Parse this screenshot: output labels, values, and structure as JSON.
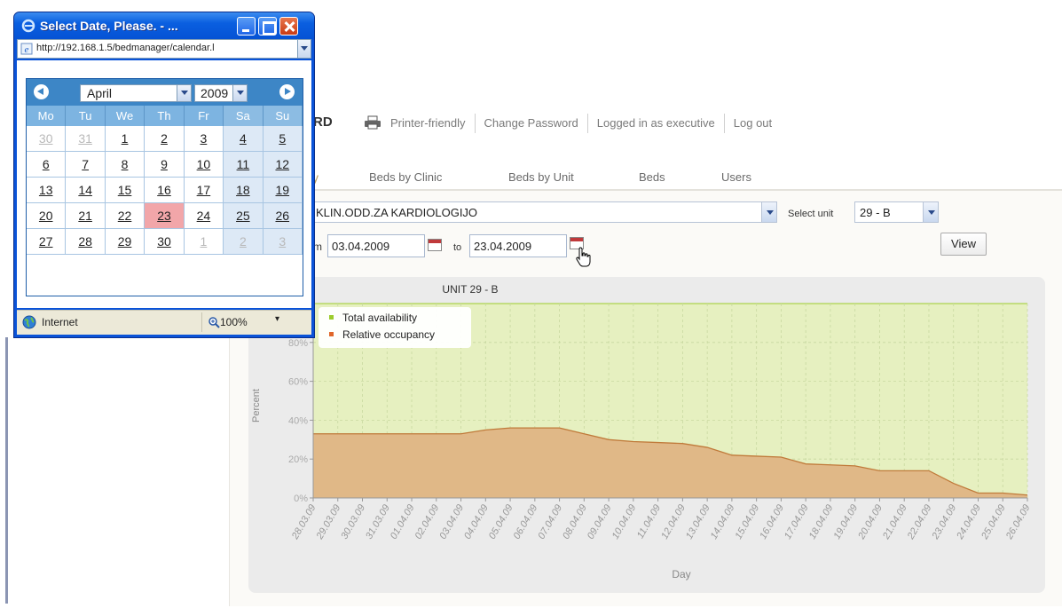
{
  "page": {
    "title_fragment": "RD",
    "nav": {
      "printer_friendly": "Printer-friendly",
      "change_password": "Change Password",
      "logged_in_prefix": "Logged in as",
      "logged_in_user": "executive",
      "log_out": "Log out"
    },
    "tabs": [
      "Beds by Clinic",
      "Beds by Unit",
      "Beds",
      "Users"
    ],
    "active_tab_fragment": "y",
    "clinic_select": "KLIN.ODD.ZA KARDIOLOGIJO",
    "select_unit_label": "Select unit",
    "unit_select": "29 - B",
    "from_label_fragment": "m",
    "from_date": "03.04.2009",
    "to_label": "to",
    "to_date": "23.04.2009",
    "view_button": "View"
  },
  "chart_data": {
    "type": "area",
    "title": "UNIT 29 - B",
    "xlabel": "Day",
    "ylabel": "Percent",
    "ylim": [
      0,
      100
    ],
    "yticks": [
      "0%",
      "20%",
      "40%",
      "60%",
      "80%"
    ],
    "grid": true,
    "legend_position": "top-left",
    "x": [
      "28.03.09",
      "29.03.09",
      "30.03.09",
      "31.03.09",
      "01.04.09",
      "02.04.09",
      "03.04.09",
      "04.04.09",
      "05.04.09",
      "06.04.09",
      "07.04.09",
      "08.04.09",
      "09.04.09",
      "10.04.09",
      "11.04.09",
      "12.04.09",
      "13.04.09",
      "14.04.09",
      "15.04.09",
      "16.04.09",
      "17.04.09",
      "18.04.09",
      "19.04.09",
      "20.04.09",
      "21.04.09",
      "22.04.09",
      "23.04.09",
      "24.04.09",
      "25.04.09",
      "26.04.09"
    ],
    "series": [
      {
        "name": "Total availability",
        "color": "#9ccc2c",
        "fill": "#e6f0c0",
        "values": [
          100,
          100,
          100,
          100,
          100,
          100,
          100,
          100,
          100,
          100,
          100,
          100,
          100,
          100,
          100,
          100,
          100,
          100,
          100,
          100,
          100,
          100,
          100,
          100,
          100,
          100,
          100,
          100,
          100,
          100
        ]
      },
      {
        "name": "Relative occupancy",
        "color": "#e0662a",
        "fill": "#e0b887",
        "values": [
          33,
          33,
          33,
          33,
          33,
          33,
          33,
          35,
          36,
          36,
          36,
          33,
          30,
          29,
          28.5,
          28,
          26,
          22,
          21.5,
          21,
          17.5,
          17,
          16.5,
          14,
          14,
          14,
          7.5,
          2.5,
          2.5,
          1.5
        ]
      }
    ]
  },
  "popup": {
    "title": "Select Date, Please. - ...",
    "address": "http://192.168.1.5/bedmanager/calendar.l",
    "month": "April",
    "year": "2009",
    "weekdays": [
      "Mo",
      "Tu",
      "We",
      "Th",
      "Fr",
      "Sa",
      "Su"
    ],
    "weeks": [
      [
        "30",
        "31",
        "1",
        "2",
        "3",
        "4",
        "5"
      ],
      [
        "6",
        "7",
        "8",
        "9",
        "10",
        "11",
        "12"
      ],
      [
        "13",
        "14",
        "15",
        "16",
        "17",
        "18",
        "19"
      ],
      [
        "20",
        "21",
        "22",
        "23",
        "24",
        "25",
        "26"
      ],
      [
        "27",
        "28",
        "29",
        "30",
        "1",
        "2",
        "3"
      ]
    ],
    "selected_day": "23",
    "status_zone": "Internet",
    "zoom": "100%",
    "zoom_dropdown": "▾"
  },
  "colors": {
    "popup_titlebar": "#0a5fe0",
    "calendar_header": "#3d86c6",
    "selected_day_bg": "#f2a6a9",
    "weekend_bg": "#dde9f6"
  }
}
